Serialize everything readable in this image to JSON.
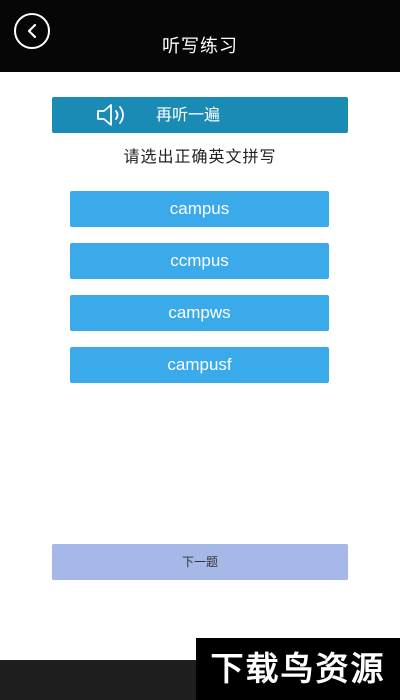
{
  "header": {
    "title": "听写练习",
    "back_icon": "chevron-left-circle-icon"
  },
  "replay": {
    "label": "再听一遍",
    "icon": "speaker-icon",
    "color": "#1a8bb4"
  },
  "instruction": "请选出正确英文拼写",
  "options": [
    {
      "label": "campus"
    },
    {
      "label": "ccmpus"
    },
    {
      "label": "campws"
    },
    {
      "label": "campusf"
    }
  ],
  "option_color": "#3aaaea",
  "next_button": {
    "label": "下一题",
    "color": "#a6b8e8"
  },
  "watermark": "下载鸟资源"
}
